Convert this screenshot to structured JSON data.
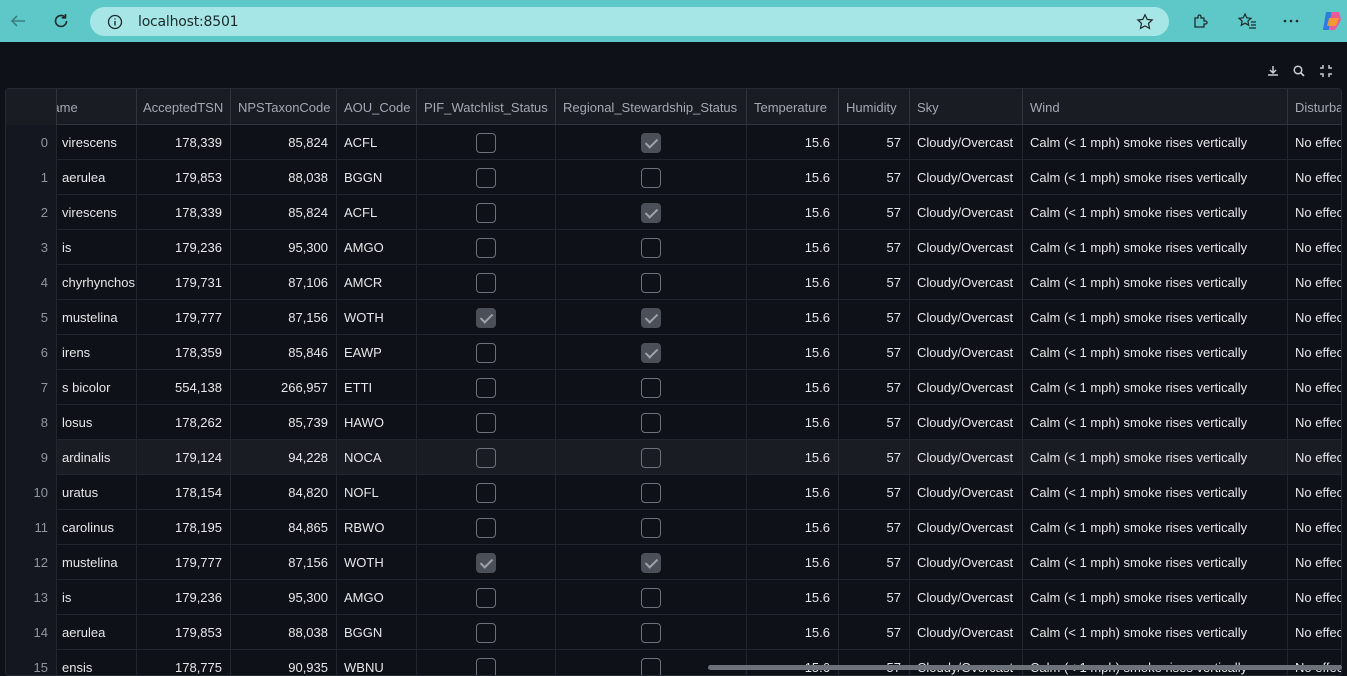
{
  "browser": {
    "url": "localhost:8501",
    "colors": {
      "chrome": "#5ec7c7",
      "urlbar": "#a6e6e6"
    }
  },
  "toolbar": {
    "icons": [
      "download-icon",
      "search-icon",
      "fullscreen-icon"
    ]
  },
  "table": {
    "columns": [
      {
        "key": "name",
        "label": "Name"
      },
      {
        "key": "tsn",
        "label": "AcceptedTSN"
      },
      {
        "key": "nps",
        "label": "NPSTaxonCode"
      },
      {
        "key": "aou",
        "label": "AOU_Code"
      },
      {
        "key": "pif",
        "label": "PIF_Watchlist_Status"
      },
      {
        "key": "reg",
        "label": "Regional_Stewardship_Status"
      },
      {
        "key": "temp",
        "label": "Temperature"
      },
      {
        "key": "hum",
        "label": "Humidity"
      },
      {
        "key": "sky",
        "label": "Sky"
      },
      {
        "key": "wind",
        "label": "Wind"
      },
      {
        "key": "dist",
        "label": "Disturbance"
      }
    ],
    "rows": [
      {
        "i": "0",
        "name": "virescens",
        "tsn": "178,339",
        "nps": "85,824",
        "aou": "ACFL",
        "pif": false,
        "reg": true,
        "temp": "15.6",
        "hum": "57",
        "sky": "Cloudy/Overcast",
        "wind": "Calm (< 1 mph) smoke rises vertically",
        "dist": "No effect"
      },
      {
        "i": "1",
        "name": "aerulea",
        "tsn": "179,853",
        "nps": "88,038",
        "aou": "BGGN",
        "pif": false,
        "reg": false,
        "temp": "15.6",
        "hum": "57",
        "sky": "Cloudy/Overcast",
        "wind": "Calm (< 1 mph) smoke rises vertically",
        "dist": "No effect"
      },
      {
        "i": "2",
        "name": "virescens",
        "tsn": "178,339",
        "nps": "85,824",
        "aou": "ACFL",
        "pif": false,
        "reg": true,
        "temp": "15.6",
        "hum": "57",
        "sky": "Cloudy/Overcast",
        "wind": "Calm (< 1 mph) smoke rises vertically",
        "dist": "No effect"
      },
      {
        "i": "3",
        "name": "is",
        "tsn": "179,236",
        "nps": "95,300",
        "aou": "AMGO",
        "pif": false,
        "reg": false,
        "temp": "15.6",
        "hum": "57",
        "sky": "Cloudy/Overcast",
        "wind": "Calm (< 1 mph) smoke rises vertically",
        "dist": "No effect"
      },
      {
        "i": "4",
        "name": "chyrhynchos",
        "tsn": "179,731",
        "nps": "87,106",
        "aou": "AMCR",
        "pif": false,
        "reg": false,
        "temp": "15.6",
        "hum": "57",
        "sky": "Cloudy/Overcast",
        "wind": "Calm (< 1 mph) smoke rises vertically",
        "dist": "No effect"
      },
      {
        "i": "5",
        "name": "mustelina",
        "tsn": "179,777",
        "nps": "87,156",
        "aou": "WOTH",
        "pif": true,
        "reg": true,
        "temp": "15.6",
        "hum": "57",
        "sky": "Cloudy/Overcast",
        "wind": "Calm (< 1 mph) smoke rises vertically",
        "dist": "No effect"
      },
      {
        "i": "6",
        "name": "irens",
        "tsn": "178,359",
        "nps": "85,846",
        "aou": "EAWP",
        "pif": false,
        "reg": true,
        "temp": "15.6",
        "hum": "57",
        "sky": "Cloudy/Overcast",
        "wind": "Calm (< 1 mph) smoke rises vertically",
        "dist": "No effect"
      },
      {
        "i": "7",
        "name": "s bicolor",
        "tsn": "554,138",
        "nps": "266,957",
        "aou": "ETTI",
        "pif": false,
        "reg": false,
        "temp": "15.6",
        "hum": "57",
        "sky": "Cloudy/Overcast",
        "wind": "Calm (< 1 mph) smoke rises vertically",
        "dist": "No effect"
      },
      {
        "i": "8",
        "name": "losus",
        "tsn": "178,262",
        "nps": "85,739",
        "aou": "HAWO",
        "pif": false,
        "reg": false,
        "temp": "15.6",
        "hum": "57",
        "sky": "Cloudy/Overcast",
        "wind": "Calm (< 1 mph) smoke rises vertically",
        "dist": "No effect"
      },
      {
        "i": "9",
        "name": "ardinalis",
        "tsn": "179,124",
        "nps": "94,228",
        "aou": "NOCA",
        "pif": false,
        "reg": false,
        "temp": "15.6",
        "hum": "57",
        "sky": "Cloudy/Overcast",
        "wind": "Calm (< 1 mph) smoke rises vertically",
        "dist": "No effect"
      },
      {
        "i": "10",
        "name": "uratus",
        "tsn": "178,154",
        "nps": "84,820",
        "aou": "NOFL",
        "pif": false,
        "reg": false,
        "temp": "15.6",
        "hum": "57",
        "sky": "Cloudy/Overcast",
        "wind": "Calm (< 1 mph) smoke rises vertically",
        "dist": "No effect"
      },
      {
        "i": "11",
        "name": "carolinus",
        "tsn": "178,195",
        "nps": "84,865",
        "aou": "RBWO",
        "pif": false,
        "reg": false,
        "temp": "15.6",
        "hum": "57",
        "sky": "Cloudy/Overcast",
        "wind": "Calm (< 1 mph) smoke rises vertically",
        "dist": "No effect"
      },
      {
        "i": "12",
        "name": "mustelina",
        "tsn": "179,777",
        "nps": "87,156",
        "aou": "WOTH",
        "pif": true,
        "reg": true,
        "temp": "15.6",
        "hum": "57",
        "sky": "Cloudy/Overcast",
        "wind": "Calm (< 1 mph) smoke rises vertically",
        "dist": "No effect"
      },
      {
        "i": "13",
        "name": "is",
        "tsn": "179,236",
        "nps": "95,300",
        "aou": "AMGO",
        "pif": false,
        "reg": false,
        "temp": "15.6",
        "hum": "57",
        "sky": "Cloudy/Overcast",
        "wind": "Calm (< 1 mph) smoke rises vertically",
        "dist": "No effect"
      },
      {
        "i": "14",
        "name": "aerulea",
        "tsn": "179,853",
        "nps": "88,038",
        "aou": "BGGN",
        "pif": false,
        "reg": false,
        "temp": "15.6",
        "hum": "57",
        "sky": "Cloudy/Overcast",
        "wind": "Calm (< 1 mph) smoke rises vertically",
        "dist": "No effect"
      },
      {
        "i": "15",
        "name": "ensis",
        "tsn": "178,775",
        "nps": "90,935",
        "aou": "WBNU",
        "pif": false,
        "reg": false,
        "temp": "15.6",
        "hum": "57",
        "sky": "Cloudy/Overcast",
        "wind": "Calm (< 1 mph) smoke rises vertically",
        "dist": "No effect"
      }
    ],
    "highlighted_row": "9"
  }
}
